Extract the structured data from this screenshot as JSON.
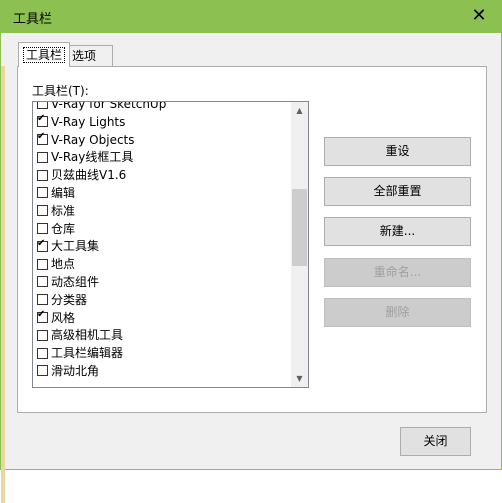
{
  "window": {
    "title": "工具栏",
    "close_symbol": "✕"
  },
  "tabs": [
    {
      "label": "工具栏"
    },
    {
      "label": "选项"
    }
  ],
  "list_label": "工具栏(T):",
  "toolbars": [
    {
      "label": "V-Ray for SketchUp",
      "checked": true
    },
    {
      "label": "V-Ray Lights",
      "checked": true
    },
    {
      "label": "V-Ray Objects",
      "checked": true
    },
    {
      "label": "V-Ray线框工具",
      "checked": false
    },
    {
      "label": "贝兹曲线V1.6",
      "checked": false
    },
    {
      "label": "编辑",
      "checked": false
    },
    {
      "label": "标准",
      "checked": false
    },
    {
      "label": "仓库",
      "checked": false
    },
    {
      "label": "大工具集",
      "checked": true
    },
    {
      "label": "地点",
      "checked": false
    },
    {
      "label": "动态组件",
      "checked": false
    },
    {
      "label": "分类器",
      "checked": false
    },
    {
      "label": "风格",
      "checked": true
    },
    {
      "label": "高级相机工具",
      "checked": false
    },
    {
      "label": "工具栏编辑器",
      "checked": false
    },
    {
      "label": "滑动北角",
      "checked": false
    }
  ],
  "scrollbar": {
    "up_glyph": "▲",
    "down_glyph": "▼"
  },
  "buttons": {
    "reset": "重设",
    "reset_all": "全部重置",
    "new": "新建...",
    "rename": "重命名...",
    "delete": "删除",
    "close": "关闭"
  },
  "colors": {
    "titlebar": "#8cc152",
    "dialog_bg": "#f0f0f0"
  }
}
